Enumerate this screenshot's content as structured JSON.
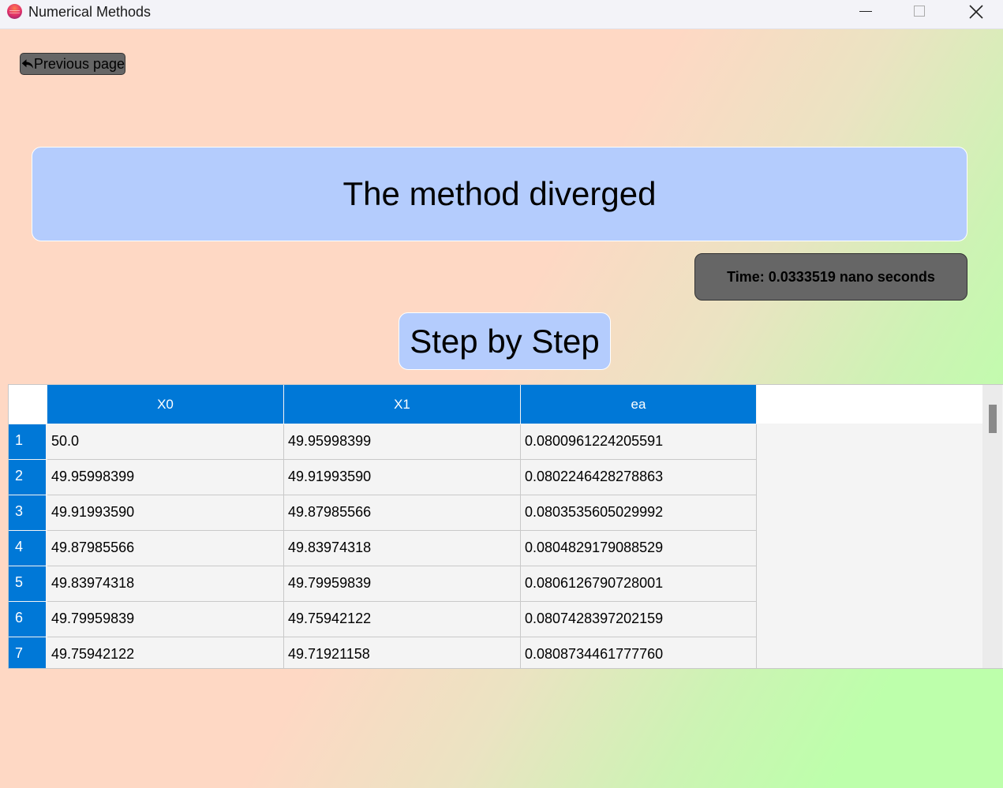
{
  "window": {
    "title": "Numerical Methods"
  },
  "toolbar": {
    "previous_label": "Previous page"
  },
  "result": {
    "message": "The method diverged",
    "time_label": "Time: 0.0333519 nano seconds"
  },
  "step_button": {
    "label": "Step by Step"
  },
  "table": {
    "columns": [
      "X0",
      "X1",
      "ea"
    ],
    "rows": [
      {
        "index": "1",
        "cells": [
          "50.0",
          "49.95998399",
          "0.0800961224205591"
        ]
      },
      {
        "index": "2",
        "cells": [
          "49.95998399",
          "49.91993590",
          "0.0802246428278863"
        ]
      },
      {
        "index": "3",
        "cells": [
          "49.91993590",
          "49.87985566",
          "0.0803535605029992"
        ]
      },
      {
        "index": "4",
        "cells": [
          "49.87985566",
          "49.83974318",
          "0.0804829179088529"
        ]
      },
      {
        "index": "5",
        "cells": [
          "49.83974318",
          "49.79959839",
          "0.0806126790728001"
        ]
      },
      {
        "index": "6",
        "cells": [
          "49.79959839",
          "49.75942122",
          "0.0807428397202159"
        ]
      },
      {
        "index": "7",
        "cells": [
          "49.75942122",
          "49.71921158",
          "0.0808734461777760"
        ]
      }
    ]
  },
  "icons": {
    "app": "app-logo-icon",
    "minimize": "minimize-icon",
    "maximize": "maximize-icon",
    "close": "close-icon",
    "back": "back-arrow-icon"
  },
  "colors": {
    "header_blue": "#0078d7",
    "banner_blue": "#b4ccfd",
    "gray_button": "#666666",
    "gradient_left": "#fed8c4",
    "gradient_right": "#bdffab"
  }
}
